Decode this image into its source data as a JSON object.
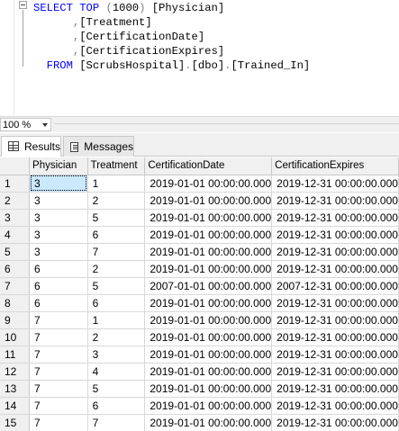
{
  "editor": {
    "lines": [
      [
        {
          "c": "kw",
          "t": "SELECT"
        },
        {
          "c": "id",
          "t": " "
        },
        {
          "c": "kw",
          "t": "TOP"
        },
        {
          "c": "id",
          "t": " "
        },
        {
          "c": "gr",
          "t": "("
        },
        {
          "c": "id",
          "t": "1000"
        },
        {
          "c": "gr",
          "t": ")"
        },
        {
          "c": "id",
          "t": " [Physician]"
        }
      ],
      [
        {
          "c": "id",
          "t": "      "
        },
        {
          "c": "gr",
          "t": ","
        },
        {
          "c": "id",
          "t": "[Treatment]"
        }
      ],
      [
        {
          "c": "id",
          "t": "      "
        },
        {
          "c": "gr",
          "t": ","
        },
        {
          "c": "id",
          "t": "[CertificationDate]"
        }
      ],
      [
        {
          "c": "id",
          "t": "      "
        },
        {
          "c": "gr",
          "t": ","
        },
        {
          "c": "id",
          "t": "[CertificationExpires]"
        }
      ],
      [
        {
          "c": "id",
          "t": "  "
        },
        {
          "c": "kw",
          "t": "FROM"
        },
        {
          "c": "id",
          "t": " [ScrubsHospital]"
        },
        {
          "c": "gr",
          "t": "."
        },
        {
          "c": "id",
          "t": "[dbo]"
        },
        {
          "c": "gr",
          "t": "."
        },
        {
          "c": "id",
          "t": "[Trained_In]"
        }
      ]
    ]
  },
  "zoom": {
    "value": "100 %"
  },
  "tabs": [
    {
      "label": "Results",
      "icon": "grid-icon",
      "active": true
    },
    {
      "label": "Messages",
      "icon": "messages-icon",
      "active": false
    }
  ],
  "results": {
    "columns": [
      "Physician",
      "Treatment",
      "CertificationDate",
      "CertificationExpires"
    ],
    "rows": [
      [
        "1",
        "3",
        "1",
        "2019-01-01 00:00:00.000",
        "2019-12-31 00:00:00.000"
      ],
      [
        "2",
        "3",
        "2",
        "2019-01-01 00:00:00.000",
        "2019-12-31 00:00:00.000"
      ],
      [
        "3",
        "3",
        "5",
        "2019-01-01 00:00:00.000",
        "2019-12-31 00:00:00.000"
      ],
      [
        "4",
        "3",
        "6",
        "2019-01-01 00:00:00.000",
        "2019-12-31 00:00:00.000"
      ],
      [
        "5",
        "3",
        "7",
        "2019-01-01 00:00:00.000",
        "2019-12-31 00:00:00.000"
      ],
      [
        "6",
        "6",
        "2",
        "2019-01-01 00:00:00.000",
        "2019-12-31 00:00:00.000"
      ],
      [
        "7",
        "6",
        "5",
        "2007-01-01 00:00:00.000",
        "2007-12-31 00:00:00.000"
      ],
      [
        "8",
        "6",
        "6",
        "2019-01-01 00:00:00.000",
        "2019-12-31 00:00:00.000"
      ],
      [
        "9",
        "7",
        "1",
        "2019-01-01 00:00:00.000",
        "2019-12-31 00:00:00.000"
      ],
      [
        "10",
        "7",
        "2",
        "2019-01-01 00:00:00.000",
        "2019-12-31 00:00:00.000"
      ],
      [
        "11",
        "7",
        "3",
        "2019-01-01 00:00:00.000",
        "2019-12-31 00:00:00.000"
      ],
      [
        "12",
        "7",
        "4",
        "2019-01-01 00:00:00.000",
        "2019-12-31 00:00:00.000"
      ],
      [
        "13",
        "7",
        "5",
        "2019-01-01 00:00:00.000",
        "2019-12-31 00:00:00.000"
      ],
      [
        "14",
        "7",
        "6",
        "2019-01-01 00:00:00.000",
        "2019-12-31 00:00:00.000"
      ],
      [
        "15",
        "7",
        "7",
        "2019-01-01 00:00:00.000",
        "2019-12-31 00:00:00.000"
      ]
    ],
    "selected_cell": {
      "row": 0,
      "col": 1
    }
  },
  "colors": {
    "keyword": "#0000ff",
    "punctuation": "#808080",
    "selection": "#cce8ff",
    "chrome": "#f0f0f0"
  }
}
